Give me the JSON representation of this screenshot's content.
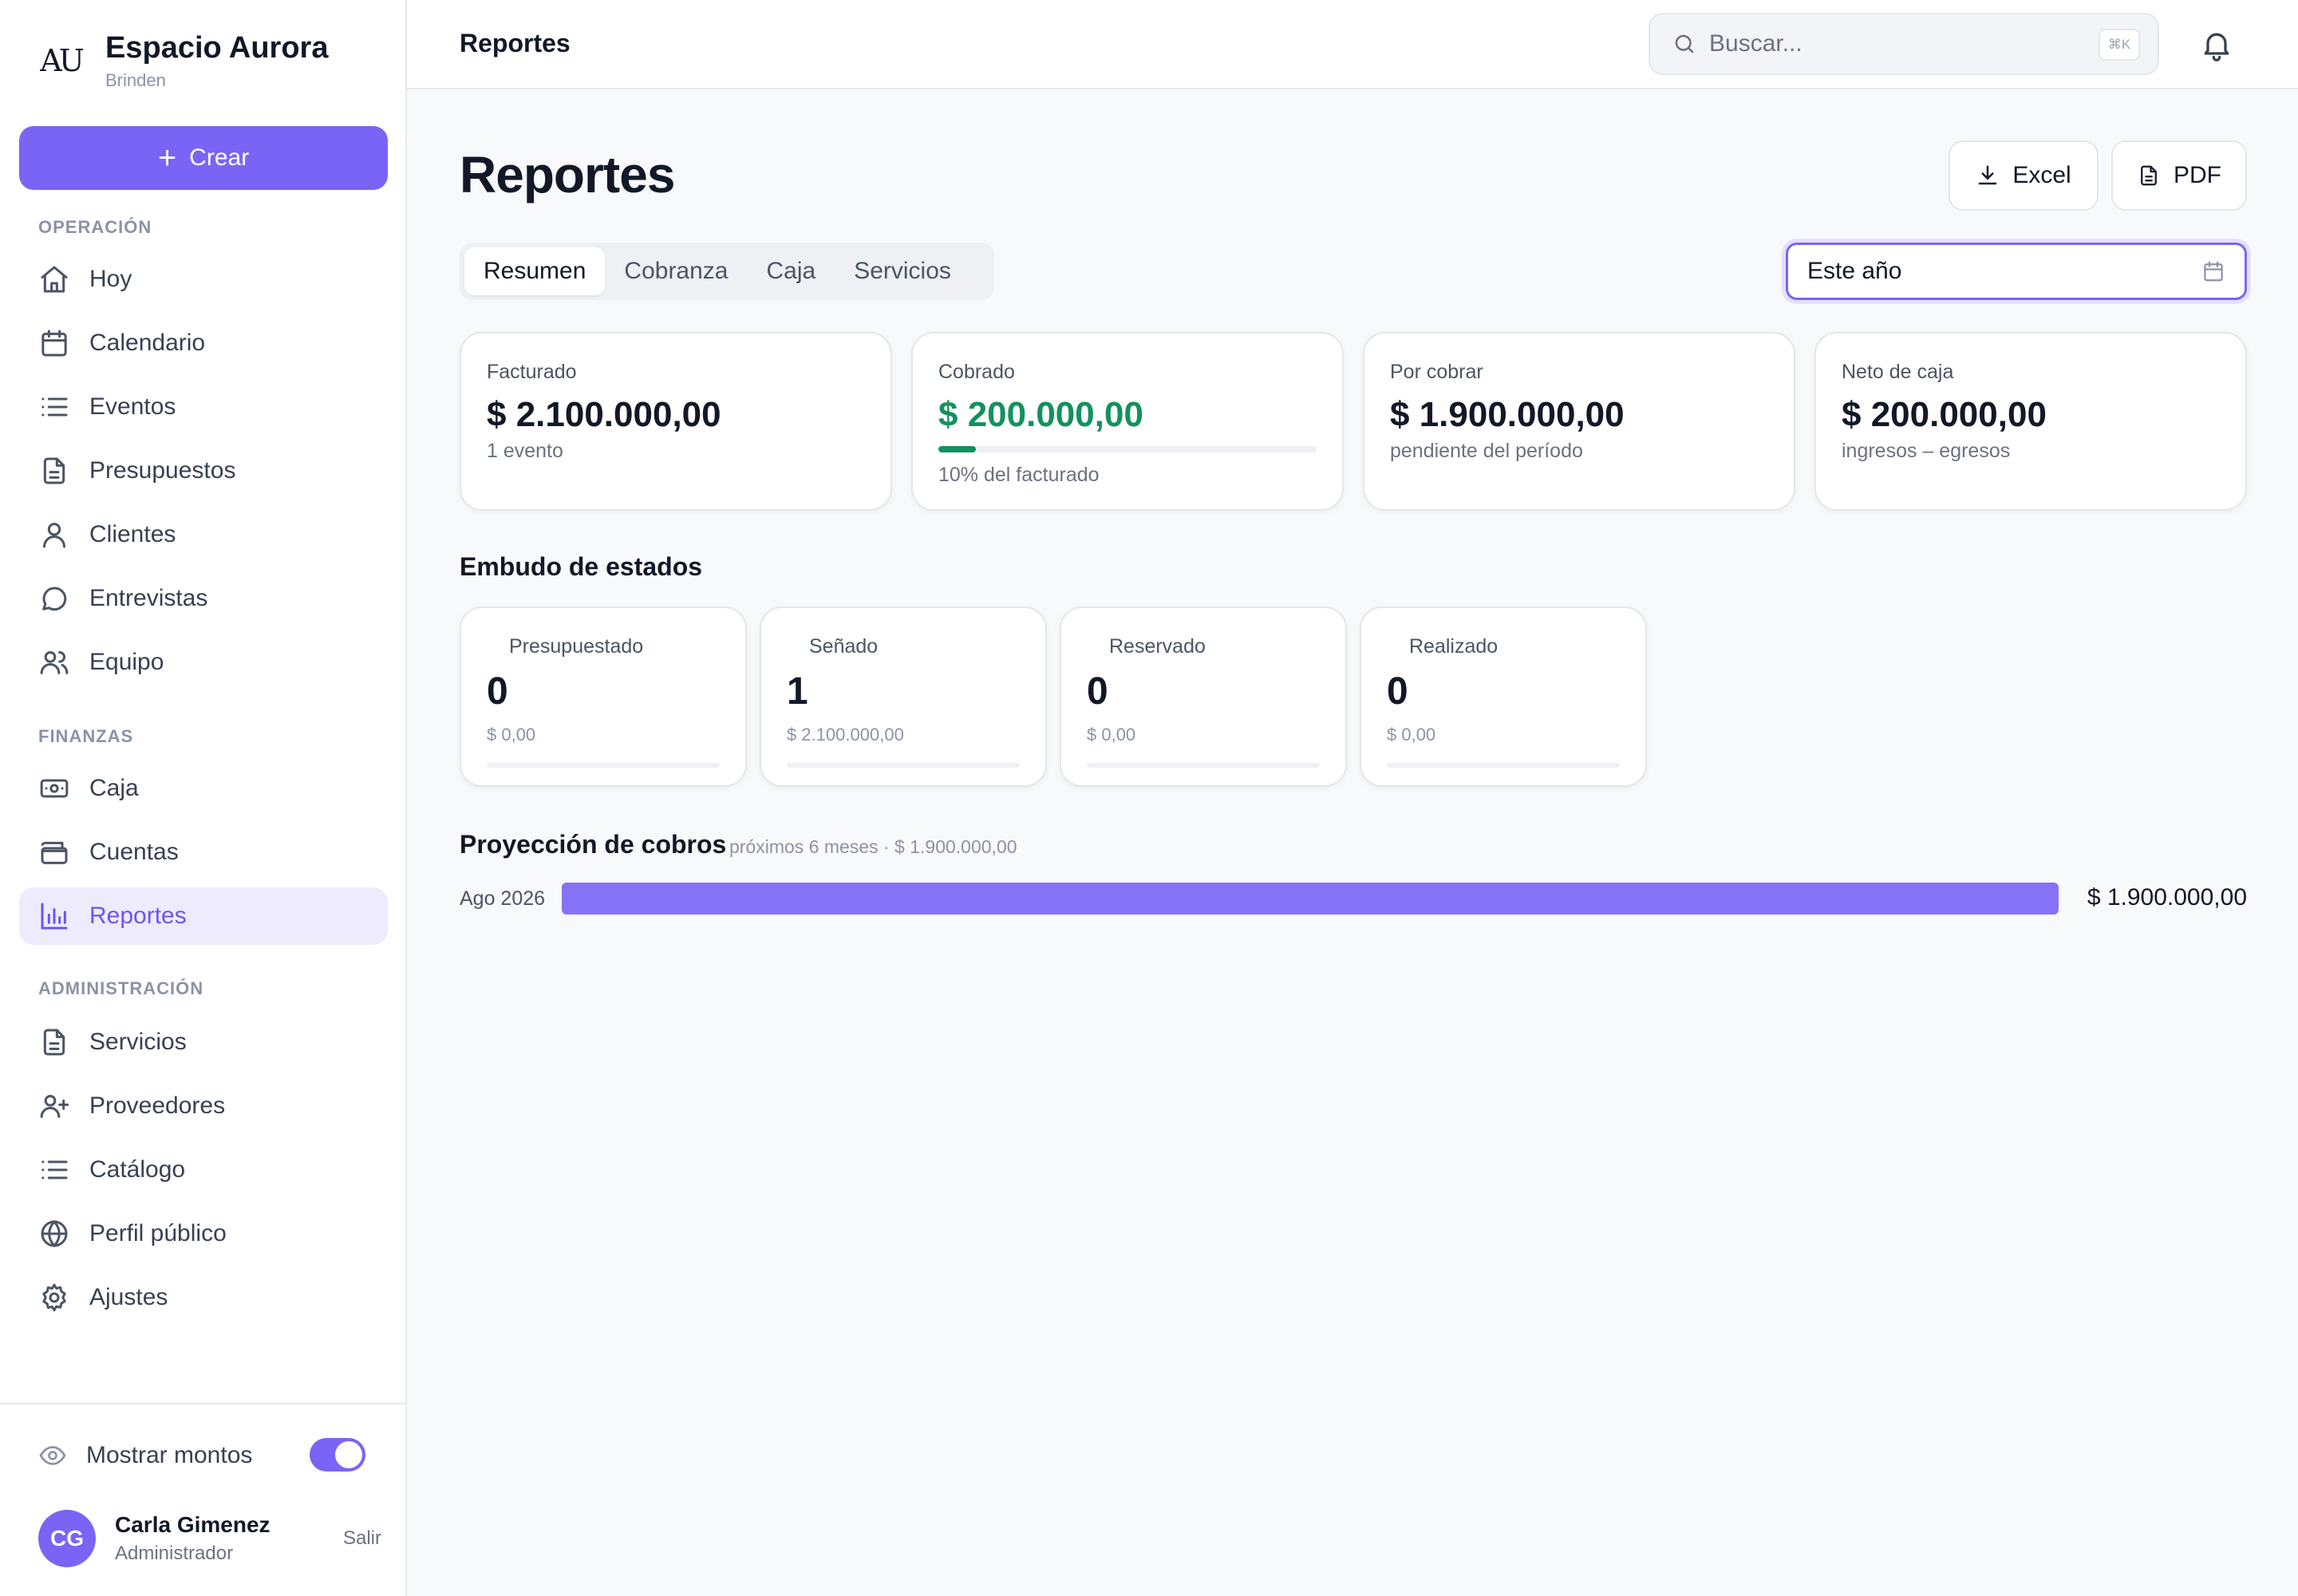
{
  "brand": {
    "logo": "AU",
    "name": "Espacio Aurora",
    "sub": "Brinden"
  },
  "sidebar": {
    "create_label": "Crear",
    "sections": [
      {
        "label": "OPERACIÓN"
      },
      {
        "label": "FINANZAS"
      },
      {
        "label": "ADMINISTRACIÓN"
      }
    ],
    "items": [
      {
        "label": "Hoy",
        "icon": "home-icon"
      },
      {
        "label": "Calendario",
        "icon": "calendar-icon"
      },
      {
        "label": "Eventos",
        "icon": "list-icon"
      },
      {
        "label": "Presupuestos",
        "icon": "document-icon"
      },
      {
        "label": "Clientes",
        "icon": "user-icon"
      },
      {
        "label": "Entrevistas",
        "icon": "chat-icon"
      },
      {
        "label": "Equipo",
        "icon": "users-icon"
      },
      {
        "label": "Caja",
        "icon": "cash-icon"
      },
      {
        "label": "Cuentas",
        "icon": "wallet-icon"
      },
      {
        "label": "Reportes",
        "icon": "bar-chart-icon",
        "active": true
      },
      {
        "label": "Servicios",
        "icon": "document-icon"
      },
      {
        "label": "Proveedores",
        "icon": "user-plus-icon"
      },
      {
        "label": "Catálogo",
        "icon": "list-icon"
      },
      {
        "label": "Perfil público",
        "icon": "globe-icon"
      },
      {
        "label": "Ajustes",
        "icon": "gear-icon"
      }
    ],
    "toggle_label": "Mostrar montos",
    "toggle_on": true,
    "user": {
      "initials": "CG",
      "name": "Carla Gimenez",
      "role": "Administrador",
      "logout": "Salir"
    }
  },
  "topbar": {
    "title": "Reportes",
    "search_placeholder": "Buscar...",
    "search_shortcut": "⌘K"
  },
  "main": {
    "title": "Reportes",
    "excel_label": "Excel",
    "pdf_label": "PDF",
    "tabs": [
      {
        "label": "Resumen",
        "active": true
      },
      {
        "label": "Cobranza"
      },
      {
        "label": "Caja"
      },
      {
        "label": "Servicios"
      }
    ],
    "period": "Este año",
    "stats": [
      {
        "label": "Facturado",
        "value": "$ 2.100.000,00",
        "sub": "1 evento"
      },
      {
        "label": "Cobrado",
        "value": "$ 200.000,00",
        "sub": "10% del facturado",
        "progress": 0.1
      },
      {
        "label": "Por cobrar",
        "value": "$ 1.900.000,00",
        "sub": "pendiente del período"
      },
      {
        "label": "Neto de caja",
        "value": "$ 200.000,00",
        "sub": "ingresos – egresos"
      }
    ],
    "funnel_title": "Embudo de estados",
    "funnel": [
      {
        "label": "Presupuestado",
        "count": "0",
        "amount": "$ 0,00"
      },
      {
        "label": "Señado",
        "count": "1",
        "amount": "$ 2.100.000,00"
      },
      {
        "label": "Reservado",
        "count": "0",
        "amount": "$ 0,00"
      },
      {
        "label": "Realizado",
        "count": "0",
        "amount": "$ 0,00"
      }
    ],
    "projection": {
      "title": "Proyección de cobros",
      "subtitle": "próximos 6 meses · $ 1.900.000,00",
      "rows": [
        {
          "month": "Ago 2026",
          "amount": "$ 1.900.000,00",
          "share": 1.0
        }
      ]
    }
  },
  "colors": {
    "accent": "#7a64f5",
    "accent_soft": "#eeebfe",
    "success": "#13915d",
    "projection_bar": "#8672f7"
  }
}
